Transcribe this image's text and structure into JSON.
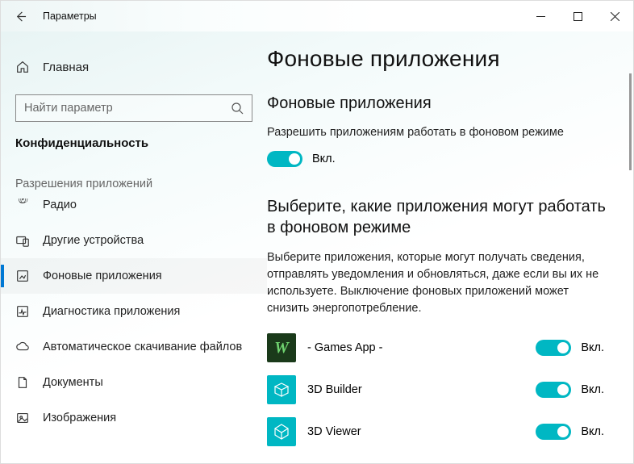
{
  "window": {
    "title": "Параметры"
  },
  "sidebar": {
    "home": "Главная",
    "search_placeholder": "Найти параметр",
    "category": "Конфиденциальность",
    "section_label": "Разрешения приложений",
    "items": [
      {
        "label": "Радио"
      },
      {
        "label": "Другие устройства"
      },
      {
        "label": "Фоновые приложения"
      },
      {
        "label": "Диагностика приложения"
      },
      {
        "label": "Автоматическое скачивание файлов"
      },
      {
        "label": "Документы"
      },
      {
        "label": "Изображения"
      }
    ]
  },
  "content": {
    "title": "Фоновые приложения",
    "subheading1": "Фоновые приложения",
    "allow_desc": "Разрешить приложениям работать в фоновом режиме",
    "main_toggle_label": "Вкл.",
    "subheading2": "Выберите, какие приложения могут работать в фоновом режиме",
    "choose_desc": "Выберите приложения, которые могут получать сведения, отправлять уведомления и обновляться, даже если вы их не используете. Выключение фоновых приложений может снизить энергопотребление.",
    "apps": [
      {
        "name": "- Games App -",
        "toggle_label": "Вкл.",
        "icon_bg": "#1a3a1a",
        "icon_letter": "W",
        "icon_color": "#6fd36f"
      },
      {
        "name": "3D Builder",
        "toggle_label": "Вкл.",
        "icon_bg": "#00b7c3",
        "icon_letter": "▭",
        "icon_color": "#fff"
      },
      {
        "name": "3D Viewer",
        "toggle_label": "Вкл.",
        "icon_bg": "#00b7c3",
        "icon_letter": "⬡",
        "icon_color": "#fff"
      }
    ]
  }
}
